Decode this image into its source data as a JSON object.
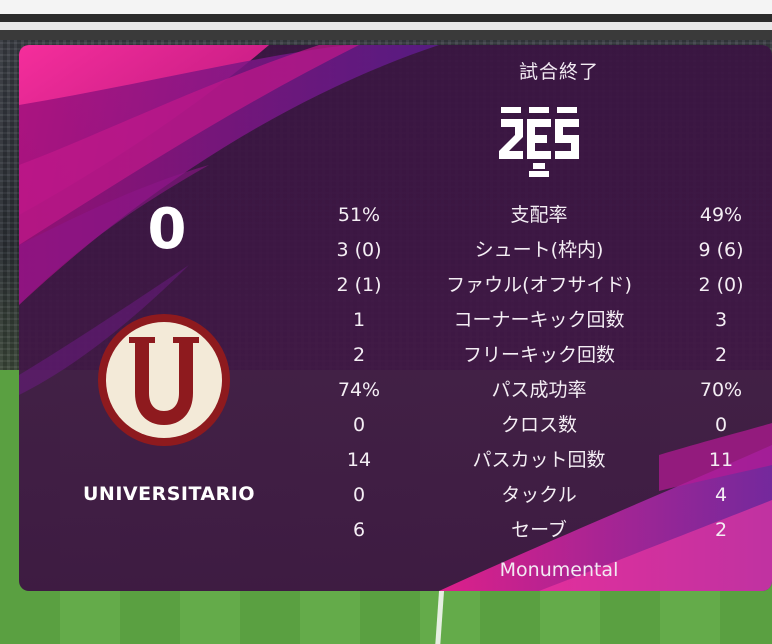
{
  "match": {
    "status": "試合終了",
    "home_score": "0",
    "home_team": "UNIVERSITARIO",
    "stadium": "Monumental"
  },
  "stats": [
    {
      "label": "支配率",
      "home": "51%",
      "away": "49%"
    },
    {
      "label": "シュート(枠内)",
      "home": "3 (0)",
      "away": "9 (6)"
    },
    {
      "label": "ファウル(オフサイド)",
      "home": "2 (1)",
      "away": "2 (0)"
    },
    {
      "label": "コーナーキック回数",
      "home": "1",
      "away": "3"
    },
    {
      "label": "フリーキック回数",
      "home": "2",
      "away": "2"
    },
    {
      "label": "パス成功率",
      "home": "74%",
      "away": "70%"
    },
    {
      "label": "クロス数",
      "home": "0",
      "away": "0"
    },
    {
      "label": "パスカット回数",
      "home": "14",
      "away": "11"
    },
    {
      "label": "タックル",
      "home": "0",
      "away": "4"
    },
    {
      "label": "セーブ",
      "home": "6",
      "away": "2"
    }
  ],
  "colors": {
    "panel": "#3d1545",
    "accent_magenta": "#e0208a",
    "crest_red": "#8e1a1e",
    "crest_cream": "#f3ead8"
  },
  "icons": {
    "logo": "pes-logo-icon",
    "crest": "universitario-crest-icon"
  }
}
